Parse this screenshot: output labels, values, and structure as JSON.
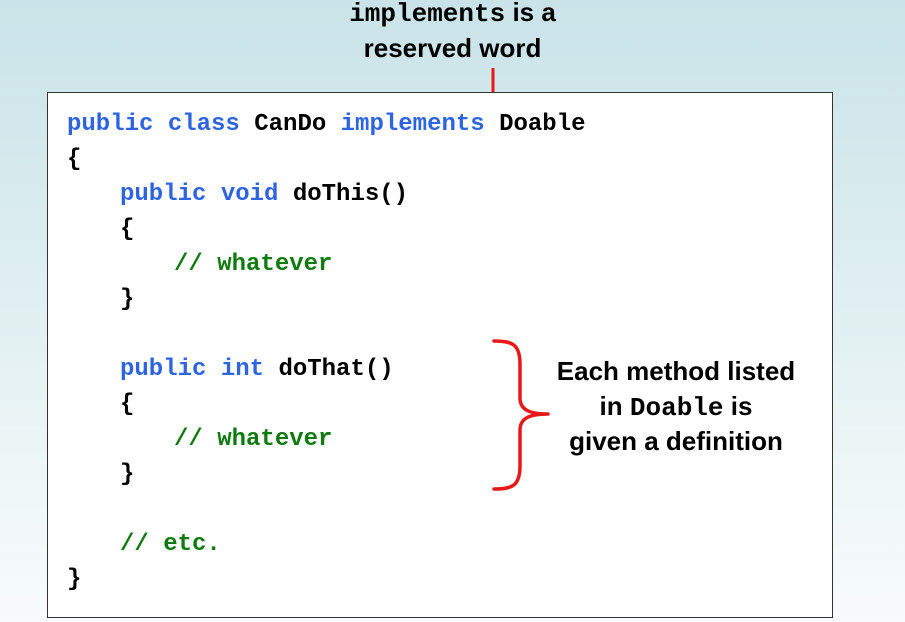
{
  "annotation_top": {
    "keyword": "implements",
    "line1_rest": " is a",
    "line2": "reserved word"
  },
  "code": {
    "l1_kw": "public class",
    "l1_name": "CanDo",
    "l1_kw2": "implements",
    "l1_iface": "Doable",
    "l2": "{",
    "l3_kw": "public void",
    "l3_rest": "doThis()",
    "l4": "{",
    "l5_comment": "// whatever",
    "l6": "}",
    "l8_kw": "public int",
    "l8_rest": "doThat()",
    "l9": "{",
    "l10_comment": "// whatever",
    "l11": "}",
    "l13_comment": "// etc.",
    "l14": "}"
  },
  "annotation_side": {
    "line1": "Each method listed",
    "line2_pre": "in ",
    "line2_mono": "Doable",
    "line2_post": " is",
    "line3": "given a definition"
  },
  "colors": {
    "keyword": "#2e64e0",
    "comment": "#0f7a0f",
    "annotation_red": "#e81818"
  }
}
